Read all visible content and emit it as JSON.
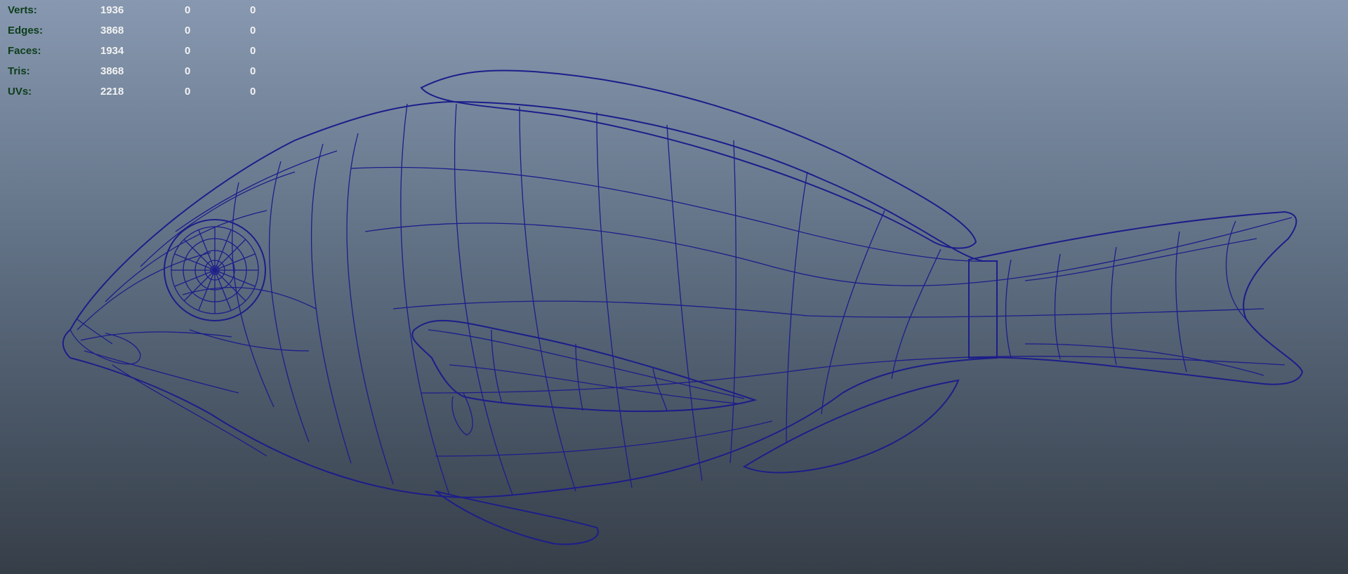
{
  "hud": {
    "rows": [
      {
        "label": "Verts:",
        "total": "1936",
        "selected": "0",
        "uv": "0"
      },
      {
        "label": "Edges:",
        "total": "3868",
        "selected": "0",
        "uv": "0"
      },
      {
        "label": "Faces:",
        "total": "1934",
        "selected": "0",
        "uv": "0"
      },
      {
        "label": "Tris:",
        "total": "3868",
        "selected": "0",
        "uv": "0"
      },
      {
        "label": "UVs:",
        "total": "2218",
        "selected": "0",
        "uv": "0"
      }
    ]
  },
  "viewport": {
    "background_top": "#8798b0",
    "background_bottom": "#363e48",
    "wireframe_color": "#1d1d8a",
    "shaded_color": "#7a7a7a",
    "model": "fish-mesh"
  }
}
